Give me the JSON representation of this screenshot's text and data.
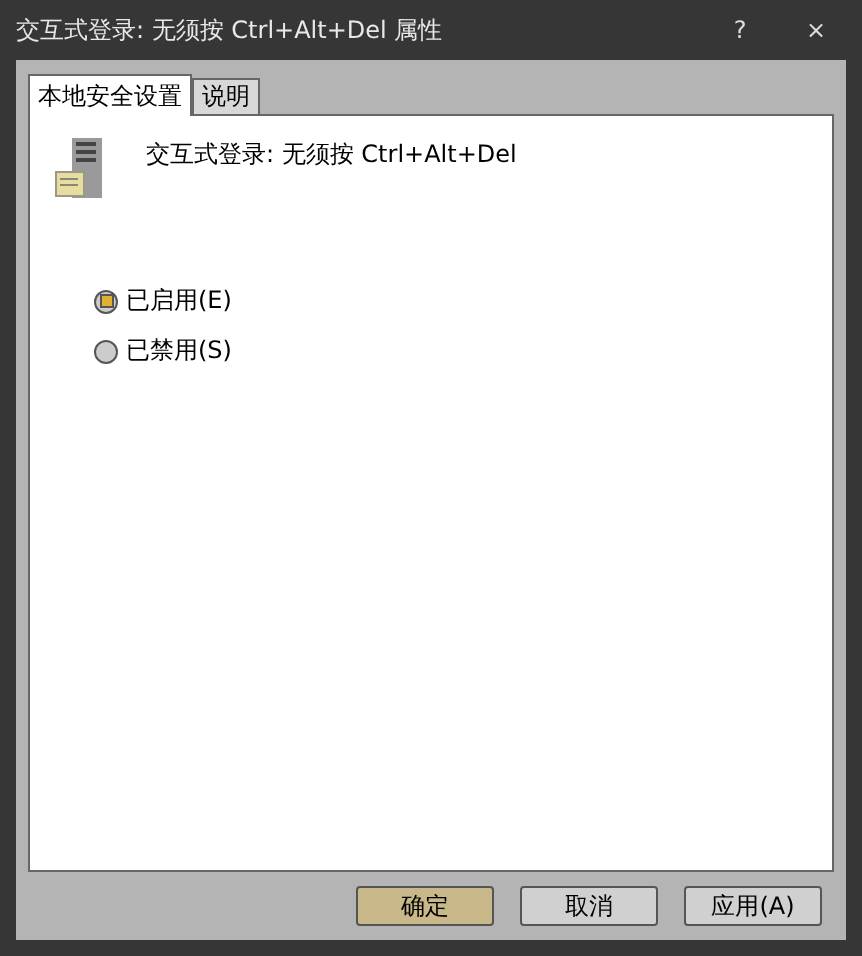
{
  "window": {
    "title": "交互式登录: 无须按 Ctrl+Alt+Del 属性",
    "help": "?",
    "close": "×"
  },
  "tabs": [
    {
      "label": "本地安全设置",
      "selected": true
    },
    {
      "label": "说明",
      "selected": false
    }
  ],
  "policy": {
    "name": "交互式登录: 无须按 Ctrl+Alt+Del"
  },
  "options": [
    {
      "label": "已启用(E)",
      "selected": true
    },
    {
      "label": "已禁用(S)",
      "selected": false
    }
  ],
  "buttons": [
    {
      "label": "确定",
      "kind": "default"
    },
    {
      "label": "取消",
      "kind": "normal"
    },
    {
      "label": "应用(A)",
      "kind": "normal"
    }
  ]
}
